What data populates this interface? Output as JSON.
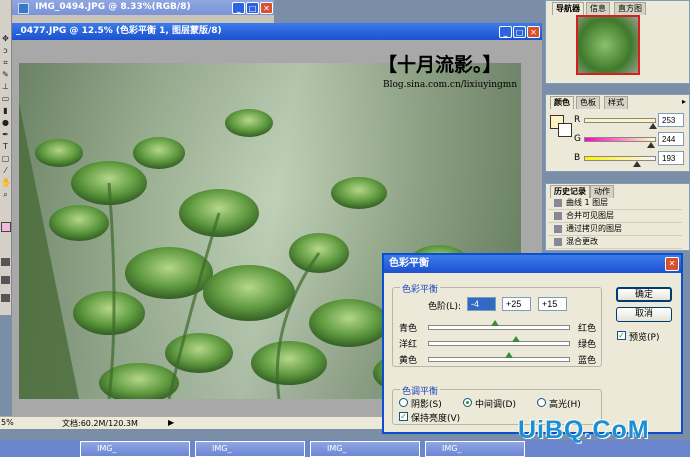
{
  "bg_window": {
    "title": "IMG_0494.JPG @ 8.33%(RGB/8)"
  },
  "main_window": {
    "title": "_0477.JPG @ 12.5% (色彩平衡 1, 图层蒙版/8)",
    "status_zoom": "5%",
    "status_doc": "文档:60.2M/120.3M"
  },
  "watermark": {
    "headline": "【十月流影。】",
    "url": "Blog.sina.com.cn/lixiuyingmn"
  },
  "brand_logo": "UiBQ.CoM",
  "navigator": {
    "tabs": [
      "导航器",
      "信息",
      "直方图"
    ]
  },
  "color_panel": {
    "tabs": [
      "颜色",
      "色板",
      "样式"
    ],
    "channels": [
      {
        "label": "R",
        "value": "253",
        "level": 0.99
      },
      {
        "label": "G",
        "value": "244",
        "level": 0.96
      },
      {
        "label": "B",
        "value": "193",
        "level": 0.76
      }
    ]
  },
  "history_panel": {
    "tabs": [
      "历史记录",
      "动作"
    ],
    "items": [
      "曲线 1 图层",
      "合并可见图层",
      "通过拷贝的图层",
      "混合更改"
    ]
  },
  "dialog": {
    "title": "色彩平衡",
    "group_color_balance": "色彩平衡",
    "levels_label": "色阶(L):",
    "levels": [
      "-4",
      "+25",
      "+15"
    ],
    "sliders": [
      {
        "left": "青色",
        "right": "红色",
        "value": -4
      },
      {
        "left": "洋红",
        "right": "绿色",
        "value": 25
      },
      {
        "left": "黄色",
        "right": "蓝色",
        "value": 15
      }
    ],
    "group_tone": "色调平衡",
    "tones": [
      {
        "label": "阴影(S)",
        "selected": false
      },
      {
        "label": "中间调(D)",
        "selected": true
      },
      {
        "label": "高光(H)",
        "selected": false
      }
    ],
    "preserve_luminosity": "保持亮度(V)",
    "ok": "确定",
    "cancel": "取消",
    "preview": "预览(P)"
  },
  "taskbar": {
    "items": [
      "IMG_",
      "IMG_",
      "IMG_",
      "IMG_"
    ]
  },
  "colors": {
    "accent": "#2a5fd8",
    "dialog_bg": "#ece9d8",
    "brand": "#1b8fd6"
  }
}
